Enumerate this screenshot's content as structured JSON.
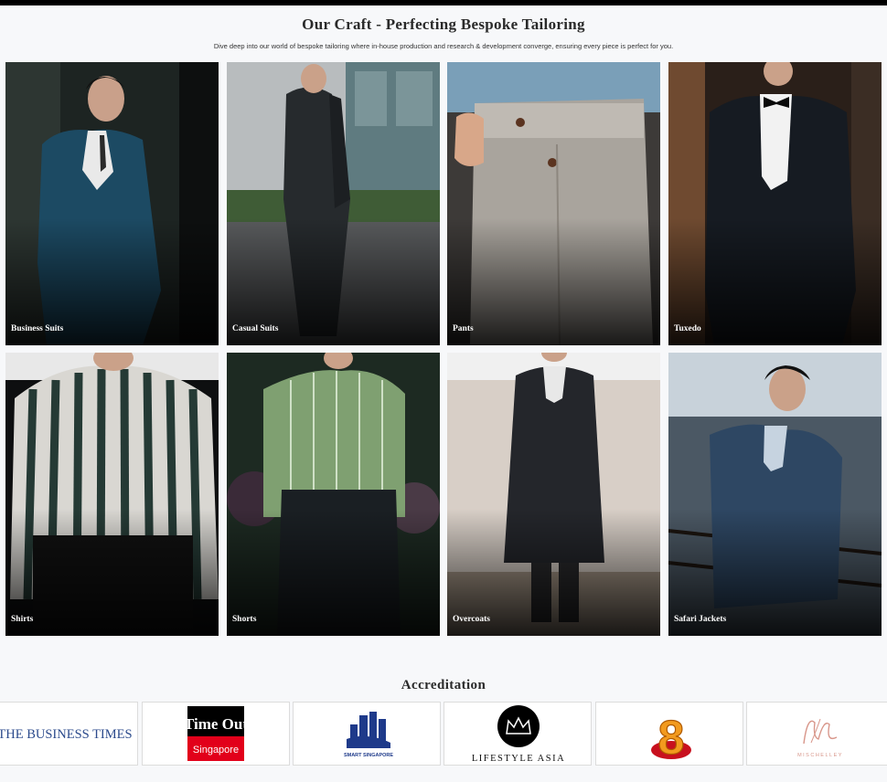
{
  "craft": {
    "title": "Our Craft - Perfecting Bespoke Tailoring",
    "subtitle": "Dive deep into our world of bespoke tailoring where in-house production and research & development converge, ensuring every piece is perfect for you.",
    "categories": [
      {
        "label": "Business Suits"
      },
      {
        "label": "Casual Suits"
      },
      {
        "label": "Pants"
      },
      {
        "label": "Tuxedo"
      },
      {
        "label": "Shirts"
      },
      {
        "label": "Shorts"
      },
      {
        "label": "Overcoats"
      },
      {
        "label": "Safari Jackets"
      }
    ]
  },
  "accreditation": {
    "title": "Accreditation",
    "logos": [
      {
        "text": "THE BUSINESS TIMES"
      },
      {
        "line1": "Time Out",
        "line2": "Singapore"
      },
      {
        "text": "SMART SINGAPORE"
      },
      {
        "text": "LIFESTYLE ASIA"
      },
      {
        "text": "8"
      },
      {
        "text": "MISCHELLEY"
      }
    ]
  },
  "colors": {
    "background": "#f7f8fa",
    "business_times_blue": "#2b4a8c",
    "timeout_red": "#e2001a",
    "channel8_orange": "#f29a1e"
  }
}
